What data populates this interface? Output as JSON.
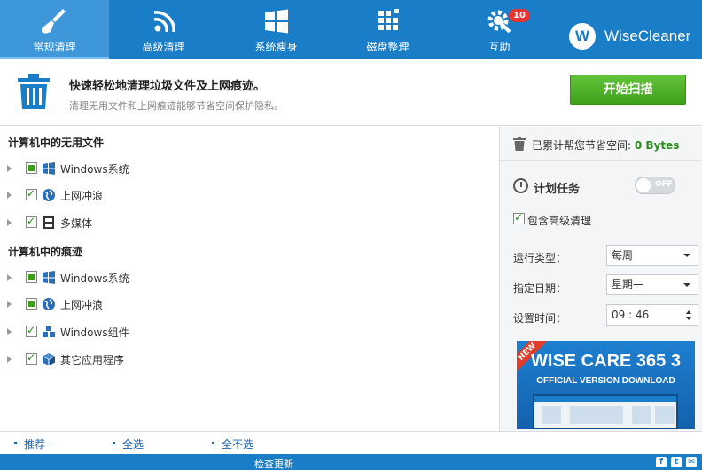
{
  "toolbar": {
    "tabs": [
      {
        "label": "常规清理",
        "icon": "broom-icon",
        "active": true
      },
      {
        "label": "高级清理",
        "icon": "network-icon",
        "active": false
      },
      {
        "label": "系统瘦身",
        "icon": "windows-icon",
        "active": false
      },
      {
        "label": "磁盘整理",
        "icon": "defrag-icon",
        "active": false
      },
      {
        "label": "互助",
        "icon": "gear-wrench-icon",
        "active": false,
        "badge": "10"
      }
    ],
    "brand_logo": "W",
    "brand_name": "WiseCleaner"
  },
  "banner": {
    "title": "快速轻松地清理垃圾文件及上网痕迹。",
    "subtitle": "清理无用文件和上网痕迹能够节省空间保护隐私。",
    "scan_label": "开始扫描"
  },
  "tree": {
    "section1_title": "计算机中的无用文件",
    "section1_items": [
      {
        "label": "Windows系统",
        "icon": "windows-icon",
        "check": "part"
      },
      {
        "label": "上网冲浪",
        "icon": "globe-icon",
        "check": "full"
      },
      {
        "label": "多媒体",
        "icon": "film-icon",
        "check": "full"
      }
    ],
    "section2_title": "计算机中的痕迹",
    "section2_items": [
      {
        "label": "Windows系统",
        "icon": "windows-icon",
        "check": "part"
      },
      {
        "label": "上网冲浪",
        "icon": "globe-icon",
        "check": "part"
      },
      {
        "label": "Windows组件",
        "icon": "components-icon",
        "check": "full"
      },
      {
        "label": "其它应用程序",
        "icon": "box-icon",
        "check": "full"
      }
    ]
  },
  "panel": {
    "saved_label": "已累计帮您节省空间:",
    "saved_value": "0 Bytes",
    "schedule_label": "计划任务",
    "toggle_text": "OFF",
    "advanced_label": "包含高级清理",
    "run_type_label": "运行类型：",
    "run_type_value": "每周",
    "day_label": "指定日期：",
    "day_value": "星期一",
    "time_label": "设置时间：",
    "time_value": "09 : 46",
    "ad_badge": "NEW",
    "ad_title": "WISE CARE 365 3",
    "ad_subtitle": "OFFICIAL VERSION DOWNLOAD"
  },
  "footer": {
    "recommend": "推荐",
    "select_all": "全选",
    "select_none": "全不选",
    "check_update": "检查更新",
    "social": [
      "f",
      "t",
      "✉"
    ]
  },
  "colors": {
    "toolbar": "#1a7dc7",
    "scan_button": "#4eb424",
    "saved_value": "#2a8a1e"
  }
}
